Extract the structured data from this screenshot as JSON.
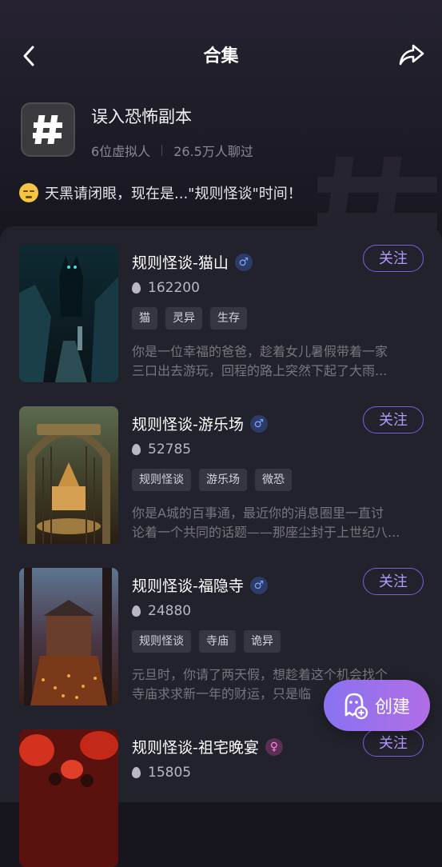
{
  "header": {
    "title": "合集",
    "back_icon": "chevron-left-icon",
    "share_icon": "share-icon"
  },
  "collection": {
    "name": "误入恐怖副本",
    "persona_count": "6位虚拟人",
    "chat_count": "26.5万人聊过",
    "description": "天黑请闭眼，现在是...\"规则怪谈\"时间！",
    "icon": "hash-icon"
  },
  "items": [
    {
      "title": "规则怪谈-猫山",
      "gender": "male",
      "gender_symbol": "♂",
      "count": "162200",
      "tags": [
        "猫",
        "灵异",
        "生存"
      ],
      "desc_line1": "你是一位幸福的爸爸，趁着女儿暑假带着一家",
      "desc_line2": "三口出去游玩，回程的路上突然下起了大雨...",
      "follow": "关注"
    },
    {
      "title": "规则怪谈-游乐场",
      "gender": "male",
      "gender_symbol": "♂",
      "count": "52785",
      "tags": [
        "规则怪谈",
        "游乐场",
        "微恐"
      ],
      "desc_line1": "你是A城的百事通，最近你的消息圈里一直讨",
      "desc_line2": "论着一个共同的话题——那座尘封于上世纪八...",
      "follow": "关注"
    },
    {
      "title": "规则怪谈-福隐寺",
      "gender": "male",
      "gender_symbol": "♂",
      "count": "24880",
      "tags": [
        "规则怪谈",
        "寺庙",
        "诡异"
      ],
      "desc_line1": "元旦时，你请了两天假，想趁着这个机会找个",
      "desc_line2": "寺庙求求新一年的财运，只是临",
      "follow": "关注"
    },
    {
      "title": "规则怪谈-祖宅晚宴",
      "gender": "female",
      "gender_symbol": "♀",
      "count": "15805",
      "tags": [],
      "desc_line1": "",
      "desc_line2": "",
      "follow": "关注"
    }
  ],
  "create_button": {
    "label": "创建",
    "icon": "ghost-plus-icon"
  },
  "colors": {
    "accent": "#7e5de0",
    "background": "#17161f",
    "panel": "#22222c"
  }
}
